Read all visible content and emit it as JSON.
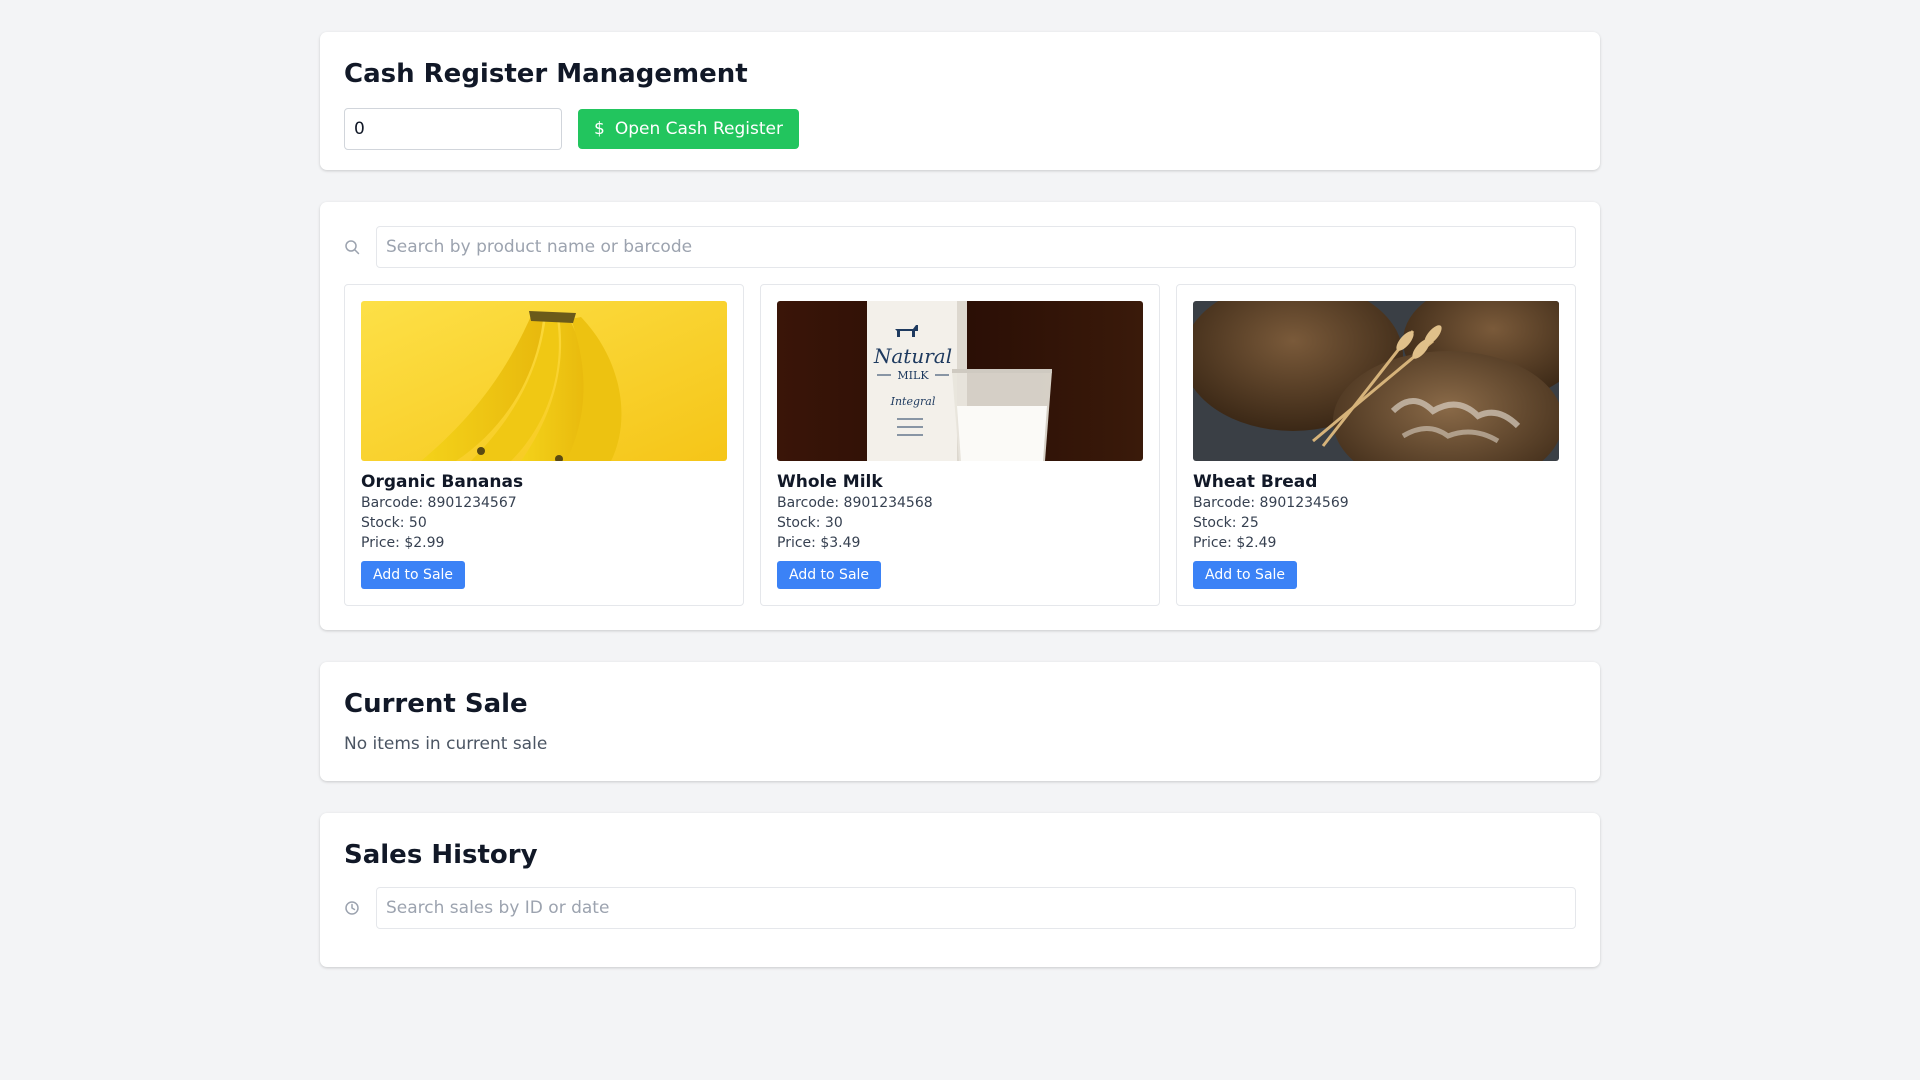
{
  "register": {
    "title": "Cash Register Management",
    "amount_value": "0",
    "open_button_icon": "$",
    "open_button_label": "Open Cash Register"
  },
  "catalog": {
    "search_placeholder": "Search by product name or barcode",
    "products": [
      {
        "name": "Organic Bananas",
        "barcode": "Barcode: 8901234567",
        "stock": "Stock: 50",
        "price": "Price: $2.99",
        "add_label": "Add to Sale",
        "image": "bananas-photo"
      },
      {
        "name": "Whole Milk",
        "barcode": "Barcode: 8901234568",
        "stock": "Stock: 30",
        "price": "Price: $3.49",
        "add_label": "Add to Sale",
        "image": "milk-photo",
        "image_text": [
          "Natural",
          "MILK",
          "Integral"
        ]
      },
      {
        "name": "Wheat Bread",
        "barcode": "Barcode: 8901234569",
        "stock": "Stock: 25",
        "price": "Price: $2.49",
        "add_label": "Add to Sale",
        "image": "bread-photo"
      }
    ]
  },
  "current_sale": {
    "title": "Current Sale",
    "empty_text": "No items in current sale"
  },
  "history": {
    "title": "Sales History",
    "search_placeholder": "Search sales by ID or date"
  },
  "colors": {
    "background": "#f3f4f6",
    "open_button": "#22c55e",
    "add_button": "#3b82f6"
  }
}
